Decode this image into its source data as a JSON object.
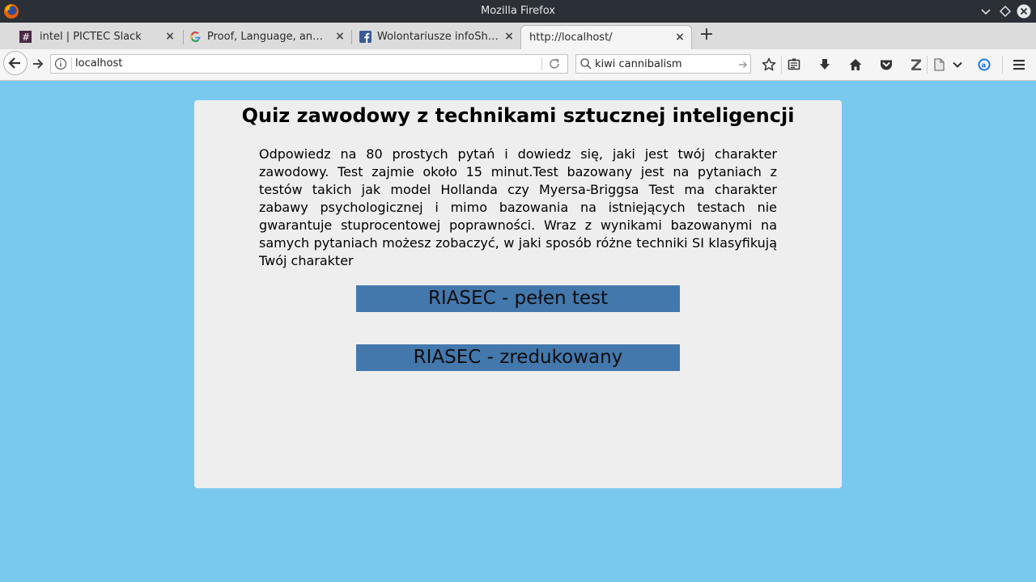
{
  "window": {
    "title": "Mozilla Firefox"
  },
  "tabs": [
    {
      "label": "intel | PICTEC Slack",
      "favicon": "slack-hash-icon"
    },
    {
      "label": "Proof, Language, and I...",
      "favicon": "google-icon"
    },
    {
      "label": "Wolontariusze infoShar...",
      "favicon": "facebook-icon"
    },
    {
      "label": "http://localhost/",
      "favicon": "none",
      "active": true
    }
  ],
  "nav": {
    "url": "localhost",
    "search_value": "kiwi cannibalism"
  },
  "page": {
    "title": "Quiz zawodowy z technikami sztucznej inteligencji",
    "description": "Odpowiedz na 80 prostych pytań i dowiedz się, jaki jest twój charakter zawodowy. Test zajmie około 15 minut.Test bazowany jest na pytaniach z testów takich jak model Hollanda czy Myersa-Briggsa Test ma charakter zabawy psychologicznej i mimo bazowania na istniejących testach nie gwarantuje stuprocentowej poprawności. Wraz z wynikami bazowanymi na samych pytaniach możesz zobaczyć, w jaki sposób różne techniki SI klasyfikują Twój charakter",
    "buttons": [
      {
        "label": "RIASEC - pełen test"
      },
      {
        "label": "RIASEC - zredukowany"
      }
    ]
  },
  "colors": {
    "page_background": "#79c9ee",
    "card_background": "#eeeeee",
    "button_background": "#4378ad"
  }
}
